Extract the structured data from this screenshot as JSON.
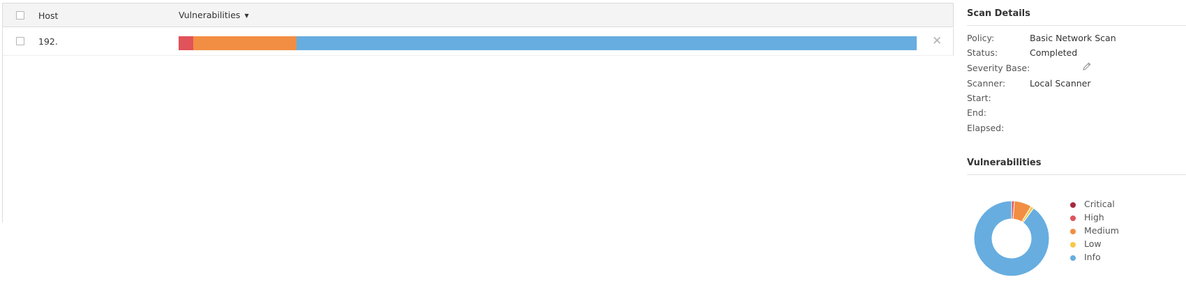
{
  "table": {
    "columns": {
      "host": "Host",
      "vulnerabilities": "Vulnerabilities"
    },
    "rows": [
      {
        "host": "192.",
        "vulnerability_distribution": [
          {
            "severity": "High",
            "fraction": 0.02,
            "color": "#e0535a"
          },
          {
            "severity": "Medium",
            "fraction": 0.14,
            "color": "#f28e43"
          },
          {
            "severity": "Info",
            "fraction": 0.84,
            "color": "#67ade0"
          }
        ],
        "remove_glyph": "✕"
      }
    ]
  },
  "scan_details": {
    "title": "Scan Details",
    "fields": [
      {
        "label": "Policy:",
        "value": "Basic Network Scan"
      },
      {
        "label": "Status:",
        "value": "Completed"
      },
      {
        "label": "Severity Base:",
        "value": ""
      },
      {
        "label": "Scanner:",
        "value": "Local Scanner"
      },
      {
        "label": "Start:",
        "value": ""
      },
      {
        "label": "End:",
        "value": ""
      },
      {
        "label": "Elapsed:",
        "value": ""
      }
    ]
  },
  "vulnerabilities_chart": {
    "title": "Vulnerabilities",
    "chart_data": {
      "type": "pie",
      "donut": true,
      "slices": [
        {
          "label": "Critical",
          "fraction": 0.0,
          "color": "#a52a3e"
        },
        {
          "label": "High",
          "fraction": 0.012,
          "color": "#e0535a"
        },
        {
          "label": "Medium",
          "fraction": 0.075,
          "color": "#f28e43"
        },
        {
          "label": "Low",
          "fraction": 0.013,
          "color": "#f8c84a"
        },
        {
          "label": "Info",
          "fraction": 0.9,
          "color": "#67ade0"
        }
      ],
      "legend_position": "right"
    }
  },
  "icons": {
    "edit": "pencil-icon",
    "sort": "caret-down-icon",
    "remove": "close-icon"
  }
}
